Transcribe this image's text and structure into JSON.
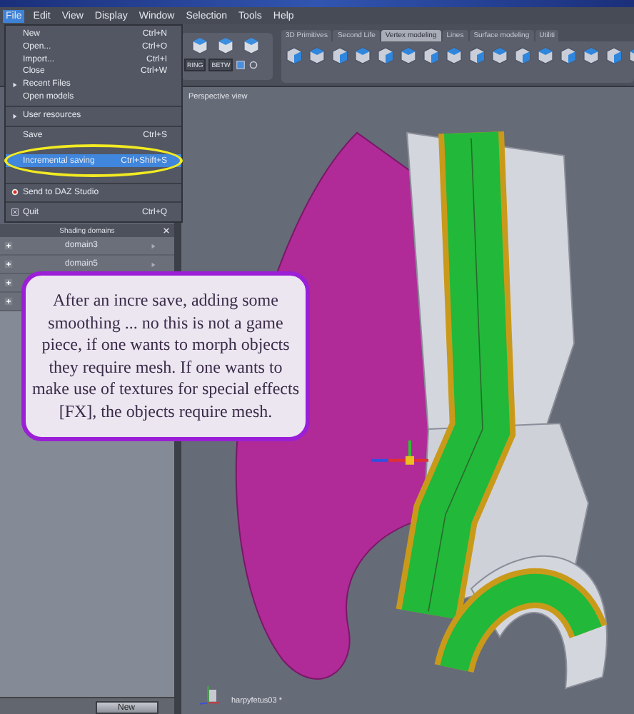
{
  "menu_bar": [
    {
      "label": "File",
      "selected": true
    },
    {
      "label": "Edit",
      "selected": false
    },
    {
      "label": "View",
      "selected": false
    },
    {
      "label": "Display",
      "selected": false
    },
    {
      "label": "Window",
      "selected": false
    },
    {
      "label": "Selection",
      "selected": false
    },
    {
      "label": "Tools",
      "selected": false
    },
    {
      "label": "Help",
      "selected": false
    }
  ],
  "file_menu": [
    {
      "kind": "plain",
      "label": "New",
      "shortcut": "Ctrl+N",
      "selected": false
    },
    {
      "kind": "plain",
      "label": "Open...",
      "shortcut": "Ctrl+O",
      "selected": false
    },
    {
      "kind": "plain",
      "label": "Import...",
      "shortcut": "Ctrl+I",
      "selected": false
    },
    {
      "kind": "plain",
      "label": "Close",
      "shortcut": "Ctrl+W",
      "selected": false
    },
    {
      "kind": "submenu",
      "label": "Recent Files",
      "selected": false
    },
    {
      "kind": "plain",
      "label": "Open models",
      "selected": false
    },
    {
      "kind": "separator"
    },
    {
      "kind": "submenu",
      "label": "User resources",
      "selected": false
    },
    {
      "kind": "separator"
    },
    {
      "kind": "plain",
      "label": "Save",
      "shortcut": "Ctrl+S",
      "selected": false
    },
    {
      "kind": "covered"
    },
    {
      "kind": "plain",
      "label": "Incremental saving",
      "shortcut": "Ctrl+Shift+S",
      "selected": true
    },
    {
      "kind": "covered"
    },
    {
      "kind": "separator"
    },
    {
      "kind": "badge",
      "label": "Send to DAZ Studio",
      "selected": false
    },
    {
      "kind": "separator"
    },
    {
      "kind": "close",
      "label": "Quit",
      "shortcut": "Ctrl+Q",
      "selected": false
    }
  ],
  "left_tools": {
    "buttons": [
      "RING",
      "BETW"
    ]
  },
  "tabs": [
    {
      "label": "3D Primitives",
      "selected": false
    },
    {
      "label": "Second Life",
      "selected": false
    },
    {
      "label": "Vertex modeling",
      "selected": true
    },
    {
      "label": "Lines",
      "selected": false
    },
    {
      "label": "Surface modeling",
      "selected": false
    },
    {
      "label": "Utiliti",
      "selected": false
    }
  ],
  "shading_domains": {
    "title": "Shading domains",
    "rows": [
      {
        "kind": "named",
        "label": "domain3"
      },
      {
        "kind": "named",
        "label": "domain5"
      },
      {
        "kind": "covered"
      },
      {
        "kind": "covered"
      }
    ],
    "button": "New"
  },
  "viewport": {
    "label": "Perspective view",
    "object_label": "harpyfetus03 *"
  },
  "callout": {
    "text": "After an incre save, adding some smoothing ... no this is not a game piece, if one wants to morph objects they require mesh. If one wants to make use of textures for special effects [FX], the objects require mesh."
  }
}
